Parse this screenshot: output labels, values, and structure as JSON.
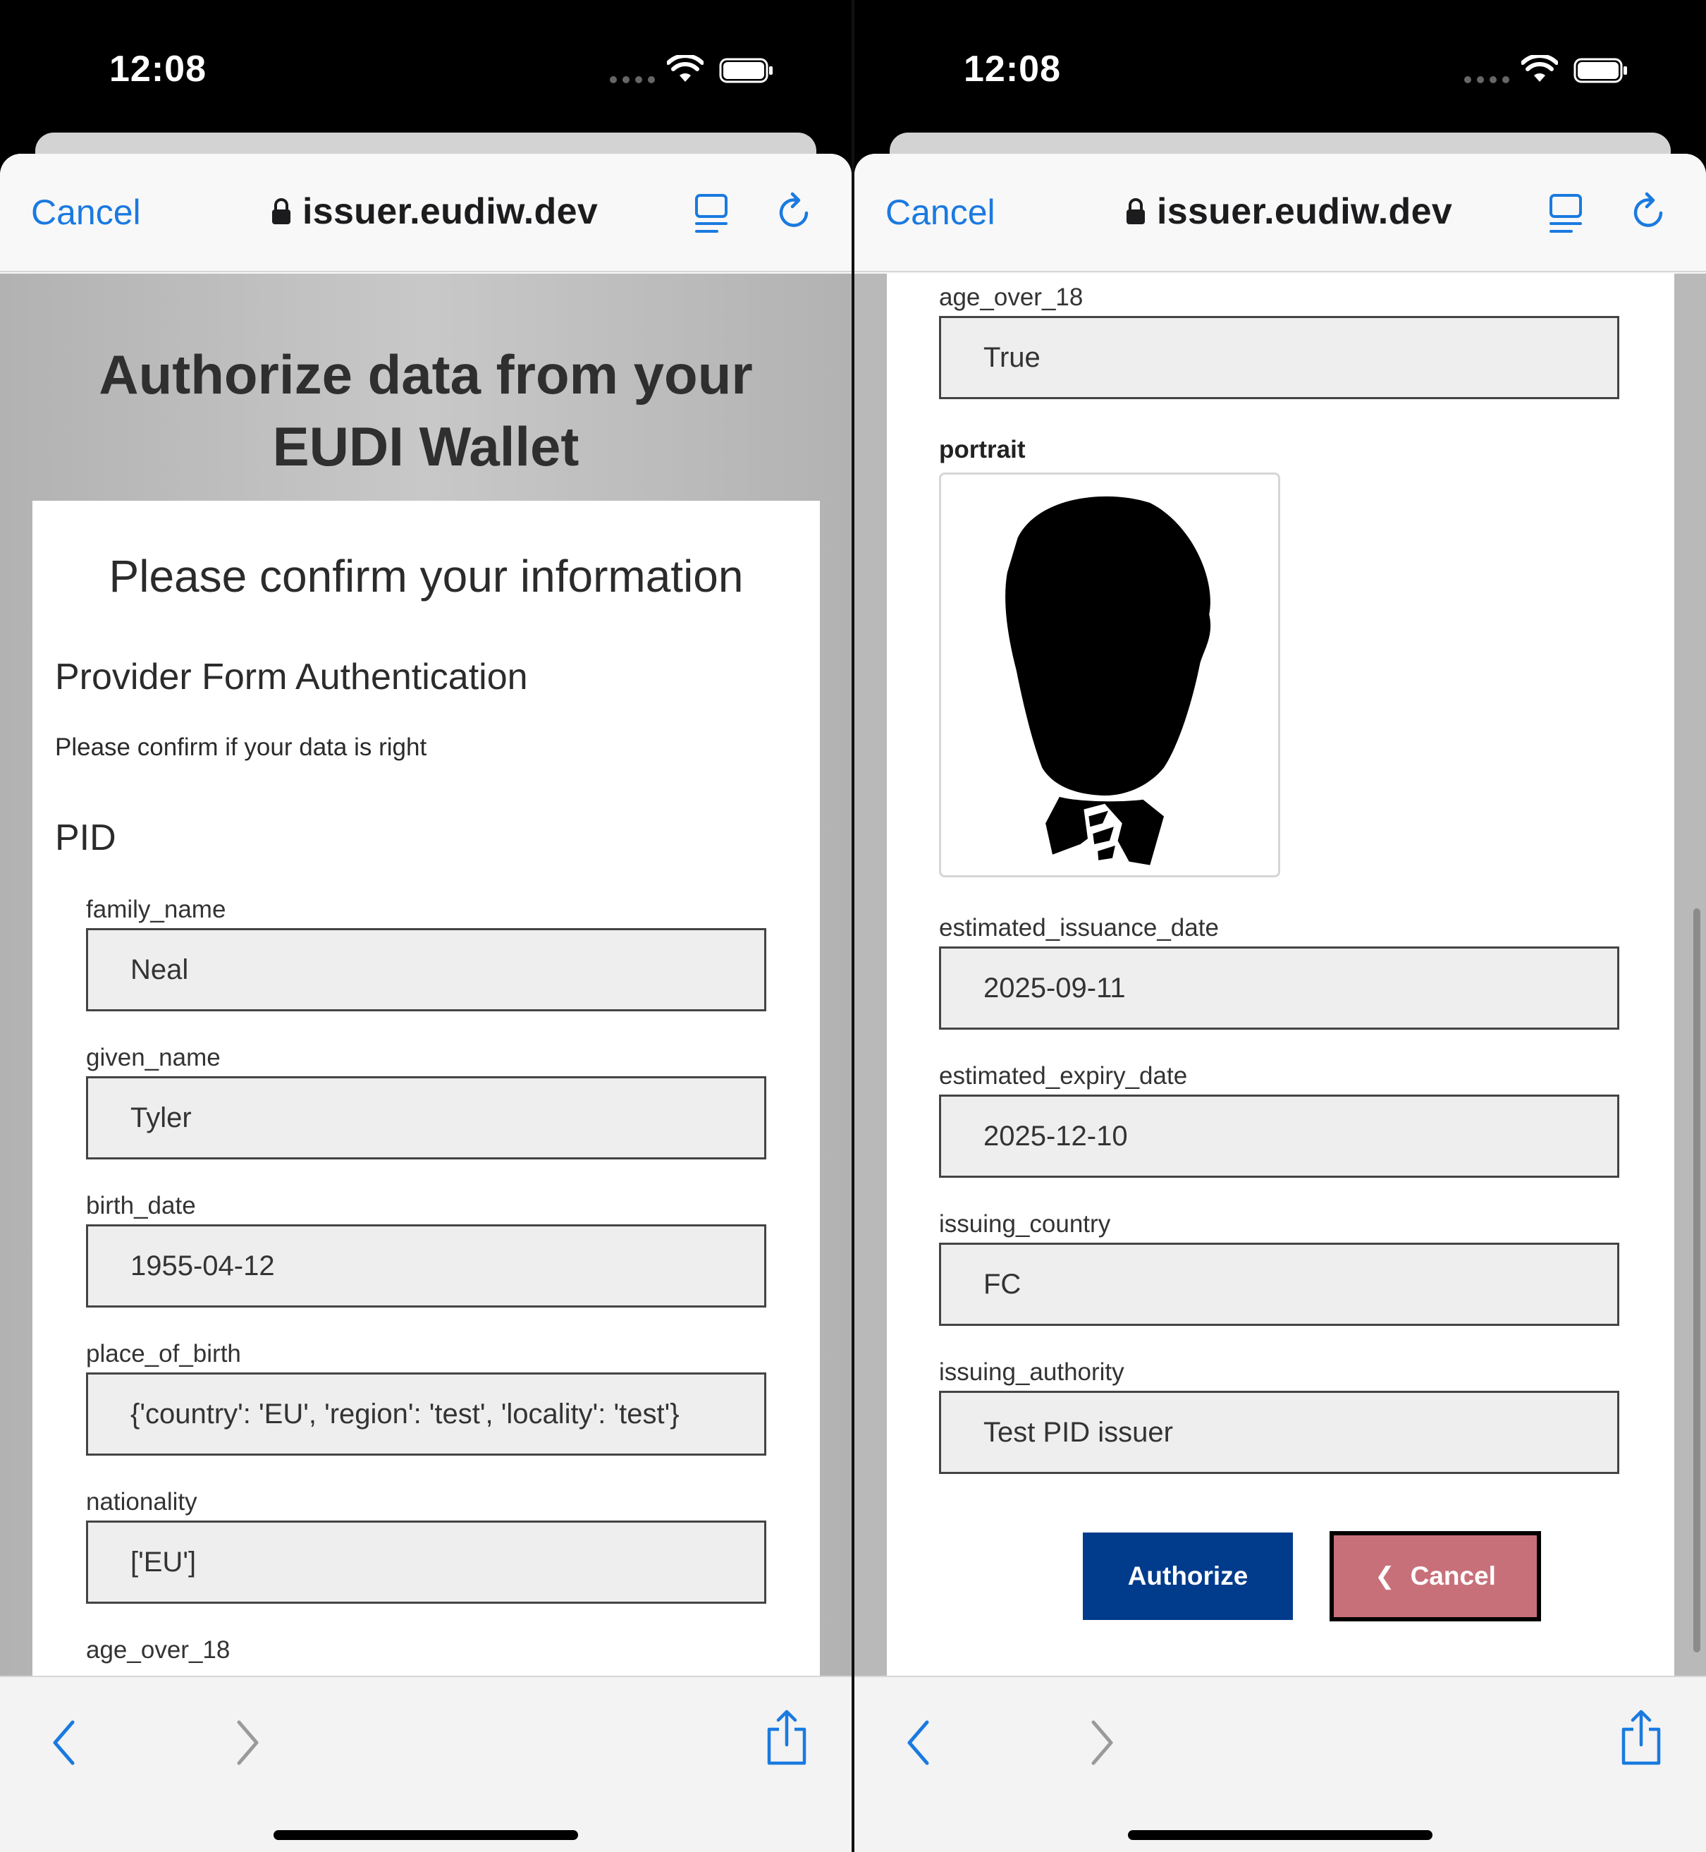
{
  "status": {
    "time": "12:08"
  },
  "browser": {
    "cancel_label": "Cancel",
    "url": "issuer.eudiw.dev"
  },
  "left_page": {
    "title_line1": "Authorize data from your",
    "title_line2": "EUDI Wallet",
    "heading": "Please confirm your information",
    "subheading": "Provider Form Authentication",
    "instruction": "Please confirm if your data is right",
    "section": "PID",
    "fields": [
      {
        "label": "family_name",
        "value": "Neal"
      },
      {
        "label": "given_name",
        "value": "Tyler"
      },
      {
        "label": "birth_date",
        "value": "1955-04-12"
      },
      {
        "label": "place_of_birth",
        "value": "{'country': 'EU', 'region': 'test', 'locality': 'test'}"
      },
      {
        "label": "nationality",
        "value": "['EU']"
      },
      {
        "label": "age_over_18",
        "value": ""
      }
    ]
  },
  "right_page": {
    "fields_top": [
      {
        "label": "age_over_18",
        "value": "True"
      }
    ],
    "portrait_label": "portrait",
    "fields_bottom": [
      {
        "label": "estimated_issuance_date",
        "value": "2025-09-11"
      },
      {
        "label": "estimated_expiry_date",
        "value": "2025-12-10"
      },
      {
        "label": "issuing_country",
        "value": "FC"
      },
      {
        "label": "issuing_authority",
        "value": "Test PID issuer"
      }
    ],
    "authorize_label": "Authorize",
    "cancel_label": "Cancel",
    "cancel_icon": "chevron-left-icon"
  },
  "colors": {
    "link_blue": "#1a7ae0",
    "authorize_bg": "#003b8c",
    "cancel_bg": "#c8707a"
  }
}
